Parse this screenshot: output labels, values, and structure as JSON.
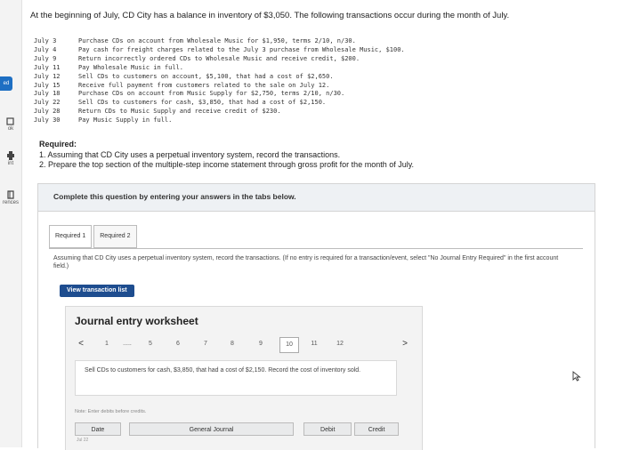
{
  "sidebar": {
    "items": [
      {
        "label": "ed"
      },
      {
        "label": "ok"
      },
      {
        "label": "int"
      },
      {
        "label": "rences"
      }
    ]
  },
  "intro": "At the beginning of July, CD City has a balance in inventory of $3,050. The following transactions occur during the month of July.",
  "transactions": [
    {
      "date": "July 3",
      "text": "Purchase CDs on account from Wholesale Music for $1,950, terms 2/10, n/30."
    },
    {
      "date": "July 4",
      "text": "Pay cash for freight charges related to the July 3 purchase from Wholesale Music, $100."
    },
    {
      "date": "July 9",
      "text": "Return incorrectly ordered CDs to Wholesale Music and receive credit, $200."
    },
    {
      "date": "July 11",
      "text": "Pay Wholesale Music in full."
    },
    {
      "date": "July 12",
      "text": "Sell CDs to customers on account, $5,100, that had a cost of $2,650."
    },
    {
      "date": "July 15",
      "text": "Receive full payment from customers related to the sale on July 12."
    },
    {
      "date": "July 18",
      "text": "Purchase CDs on account from Music Supply for $2,750, terms 2/10, n/30."
    },
    {
      "date": "July 22",
      "text": "Sell CDs to customers for cash, $3,850, that had a cost of $2,150."
    },
    {
      "date": "July 28",
      "text": "Return CDs to Music Supply and receive credit of $230."
    },
    {
      "date": "July 30",
      "text": "Pay Music Supply in full."
    }
  ],
  "required": {
    "heading": "Required:",
    "items": [
      "1. Assuming that CD City uses a perpetual inventory system, record the transactions.",
      "2. Prepare the top section of the multiple-step income statement through gross profit for the month of July."
    ]
  },
  "panel": {
    "header": "Complete this question by entering your answers in the tabs below.",
    "tabs": [
      {
        "label": "Required 1",
        "active": true
      },
      {
        "label": "Required 2",
        "active": false
      }
    ],
    "instruction": "Assuming that CD City uses a perpetual inventory system, record the transactions. (If no entry is required for a transaction/event, select \"No Journal Entry Required\" in the first account field.)",
    "view_button": "View transaction list"
  },
  "worksheet": {
    "title": "Journal entry worksheet",
    "pager": {
      "prev": "<",
      "next": ">",
      "first": "1",
      "ellipsis": ".....",
      "pages": [
        "5",
        "6",
        "7",
        "8",
        "9",
        "10",
        "11",
        "12"
      ],
      "active_page": "10"
    },
    "description": "Sell CDs to customers for cash, $3,850, that had a cost of $2,150. Record the cost of inventory sold.",
    "note": "Note: Enter debits before credits.",
    "columns": [
      "Date",
      "General Journal",
      "Debit",
      "Credit"
    ],
    "row_stub": "Jul 22"
  },
  "colors": {
    "accent": "#1e6fc3",
    "button": "#1e4d8f",
    "panel_header": "#eef1f4"
  }
}
